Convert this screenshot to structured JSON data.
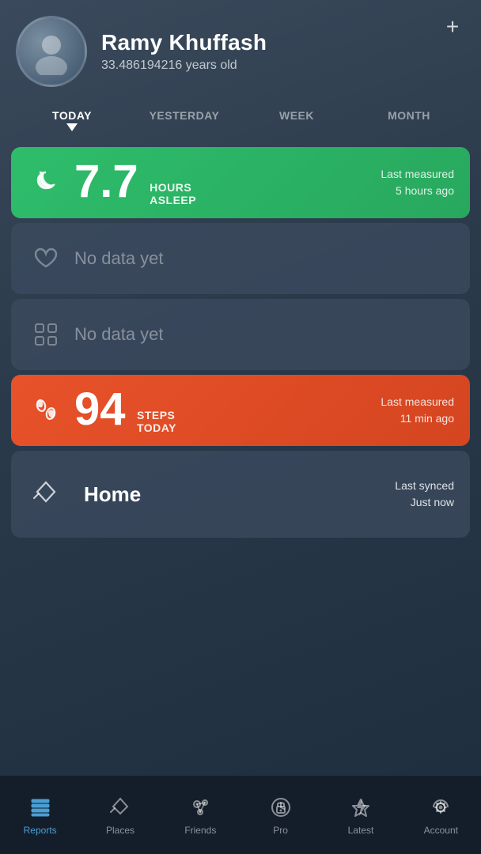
{
  "header": {
    "plus_label": "+",
    "user": {
      "name": "Ramy Khuffash",
      "age": "33.486194216 years old"
    }
  },
  "time_tabs": [
    {
      "id": "today",
      "label": "TODAY",
      "active": true
    },
    {
      "id": "yesterday",
      "label": "YESTERDAY",
      "active": false
    },
    {
      "id": "week",
      "label": "WEEK",
      "active": false
    },
    {
      "id": "month",
      "label": "MONTH",
      "active": false
    }
  ],
  "cards": [
    {
      "id": "sleep",
      "type": "green",
      "icon": "moon-icon",
      "value": "7.7",
      "label_top": "HOURS",
      "label_bottom": "ASLEEP",
      "right_line1": "Last measured",
      "right_line2": "5 hours ago"
    },
    {
      "id": "heart",
      "type": "gray",
      "icon": "heart-icon",
      "no_data": "No data yet"
    },
    {
      "id": "activity",
      "type": "gray",
      "icon": "grid-icon",
      "no_data": "No data yet"
    },
    {
      "id": "steps",
      "type": "orange",
      "icon": "steps-icon",
      "value": "94",
      "label_top": "STEPS",
      "label_bottom": "TODAY",
      "right_line1": "Last measured",
      "right_line2": "11 min ago"
    },
    {
      "id": "location",
      "type": "gray",
      "icon": "location-icon",
      "home_label": "Home",
      "right_line1": "Last synced",
      "right_line2": "Just now"
    }
  ],
  "nav": {
    "items": [
      {
        "id": "reports",
        "label": "Reports",
        "icon": "reports-icon",
        "active": true
      },
      {
        "id": "places",
        "label": "Places",
        "icon": "places-icon",
        "active": false
      },
      {
        "id": "friends",
        "label": "Friends",
        "icon": "friends-icon",
        "active": false
      },
      {
        "id": "pro",
        "label": "Pro",
        "icon": "pro-icon",
        "active": false
      },
      {
        "id": "latest",
        "label": "Latest",
        "icon": "latest-icon",
        "active": false
      },
      {
        "id": "account",
        "label": "Account",
        "icon": "account-icon",
        "active": false
      }
    ]
  }
}
